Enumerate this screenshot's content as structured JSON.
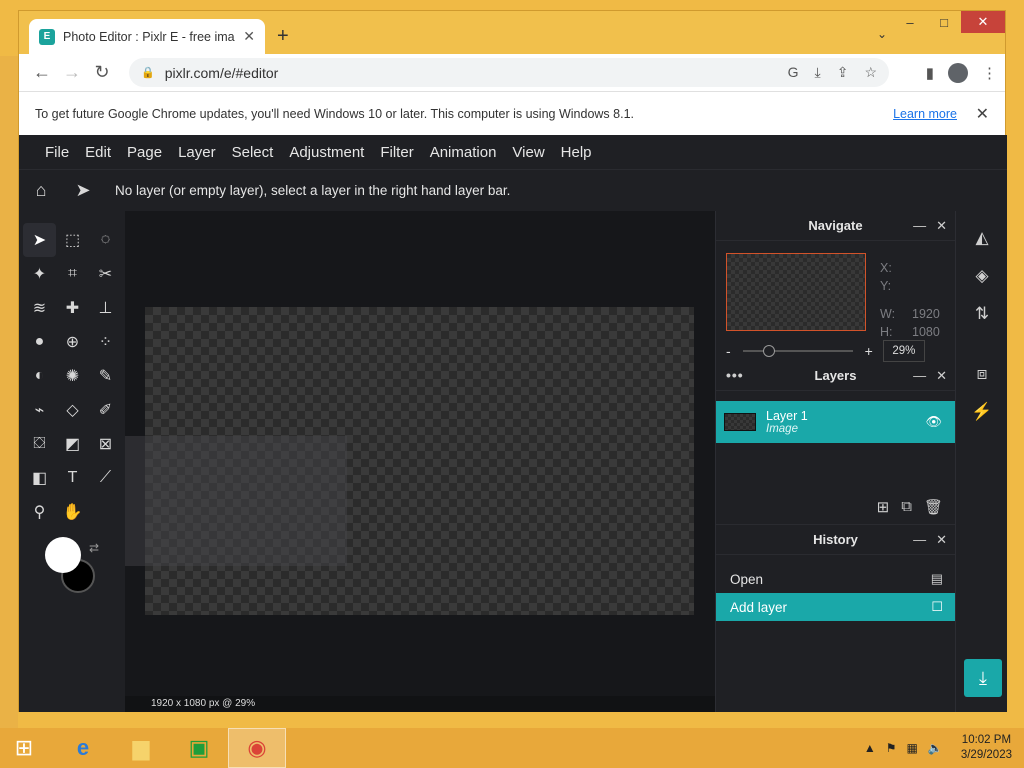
{
  "browser": {
    "tab_title": "Photo Editor : Pixlr E - free image",
    "favicon_letter": "E",
    "url": "pixlr.com/e/#editor",
    "window_controls": {
      "minimize": "–",
      "maximize": "□",
      "close": "✕"
    }
  },
  "infobar": {
    "message": "To get future Google Chrome updates, you'll need Windows 10 or later. This computer is using Windows 8.1.",
    "learn_more": "Learn more"
  },
  "menu": {
    "items": [
      "File",
      "Edit",
      "Page",
      "Layer",
      "Select",
      "Adjustment",
      "Filter",
      "Animation",
      "View",
      "Help"
    ]
  },
  "options_bar": {
    "message": "No layer (or empty layer), select a layer in the right hand layer bar."
  },
  "canvas": {
    "status": "1920 x 1080 px @ 29%"
  },
  "navigate": {
    "title": "Navigate",
    "x_label": "X:",
    "y_label": "Y:",
    "w_label": "W:",
    "w_value": "1920",
    "h_label": "H:",
    "h_value": "1080",
    "zoom_minus": "-",
    "zoom_plus": "+",
    "zoom_value": "29%",
    "zoom_level": 0.29
  },
  "layers": {
    "title": "Layers",
    "items": [
      {
        "name": "Layer 1",
        "type": "Image"
      }
    ]
  },
  "history": {
    "title": "History",
    "items": [
      {
        "label": "Open",
        "selected": false
      },
      {
        "label": "Add layer",
        "selected": true
      }
    ]
  },
  "taskbar": {
    "time": "10:02 PM",
    "date": "3/29/2023"
  },
  "colors": {
    "accent": "#1aa8a9",
    "app_bg": "#16171a",
    "panel_bg": "#1f2024",
    "foreground_color": "#ffffff",
    "background_color": "#000000"
  }
}
